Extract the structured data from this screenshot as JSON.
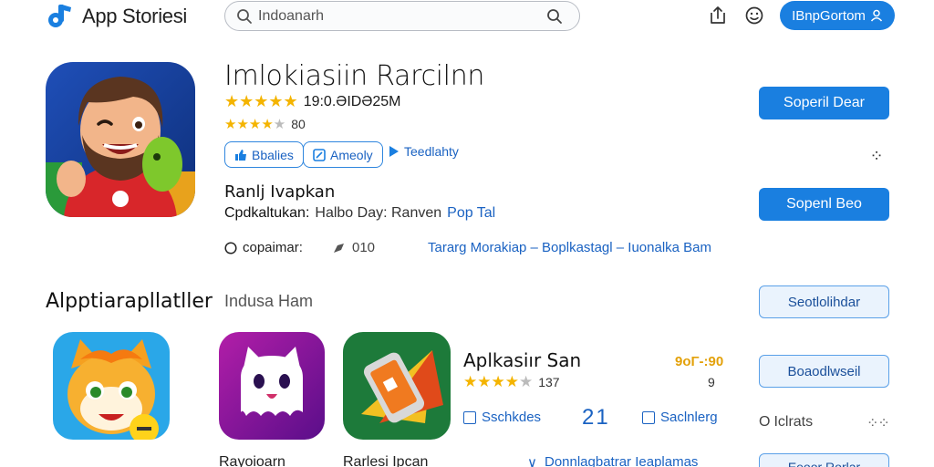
{
  "header": {
    "brand": "App Storiesi",
    "search_placeholder": "Indoanarh",
    "signin_label": "IBnpGortom"
  },
  "featured": {
    "title": "Imlokiasiin Rarcilnn",
    "rating_primary": "19:0.ƏIDƏ25M",
    "rating_secondary": "80",
    "chips": [
      "Bbalies",
      "Ameoly"
    ],
    "chip_link": "Teedlahty",
    "subheading": "Ranlj Ivapkan",
    "sub_label": "Cpdkaltukan:",
    "sub_value": "Halbo Day: Ranven",
    "sub_link": "Pop Tal",
    "meta_label": "copaimar:",
    "meta_count": "010",
    "crumbs": "Tararg Morakiap – Boplkastagl – Iuonalka Bam",
    "btn_primary": "Soperil Dear",
    "btn_secondary": "Sopenl Beo"
  },
  "section": {
    "title": "Alpptiarapllatller",
    "subtitle": "Indusa Ham",
    "btn_outline_1": "Seotlolihdar",
    "btn_outline_2": "Boaodlwseil",
    "btn_outline_3": "Eeoor Rorlar"
  },
  "apps": [
    {
      "name": ""
    },
    {
      "name": "Rayoioarn"
    },
    {
      "name": "Rarlesi Ipcan"
    }
  ],
  "list_item": {
    "title": "Aplkasiır San",
    "rating": "137",
    "price": "9oΓ-:90",
    "price_count": "9",
    "action_1": "Sschkdes",
    "action_2": "Saclnlerg",
    "big_num": "21",
    "tickets": "Iclrats",
    "more": "Donnlagbatrar Ieaplamas"
  },
  "colors": {
    "accent": "#1a7fe0",
    "link": "#1a62c2",
    "star": "#f4b400",
    "price": "#e3a10a"
  }
}
